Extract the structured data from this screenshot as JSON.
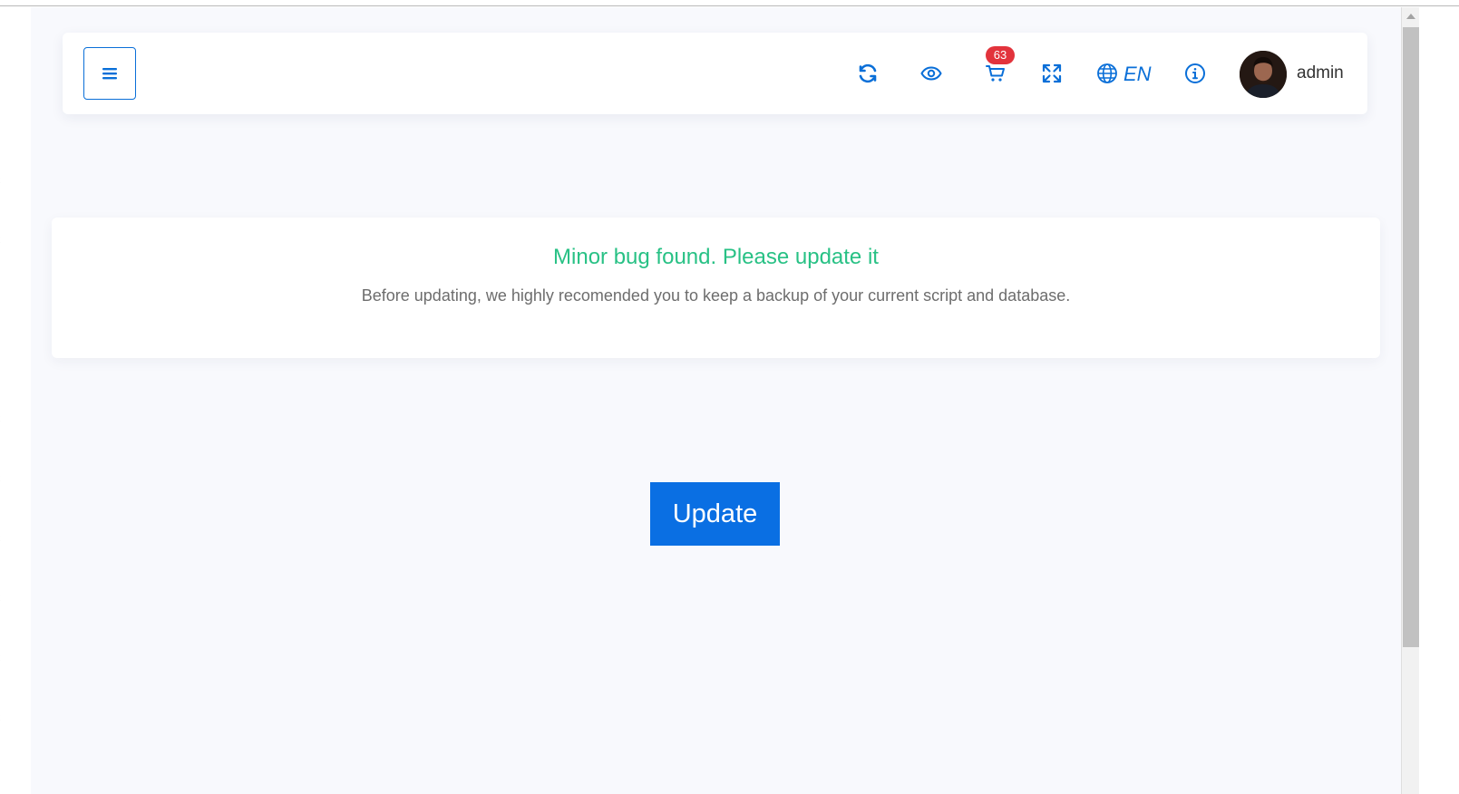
{
  "header": {
    "menu_toggle_icon": "hamburger-icon",
    "icons": [
      "refresh-icon",
      "eye-icon",
      "cart-icon",
      "fullscreen-icon",
      "globe-icon",
      "info-icon"
    ],
    "cart_badge": "63",
    "language": "EN",
    "username": "admin"
  },
  "notice": {
    "title": "Minor bug found. Please update it",
    "message": "Before updating, we highly recomended you to keep a backup of your current script and database."
  },
  "actions": {
    "update_label": "Update"
  },
  "colors": {
    "accent": "#0a6fd8",
    "success_text": "#28c185",
    "badge": "#e2333c",
    "background": "#f8f9fd"
  }
}
